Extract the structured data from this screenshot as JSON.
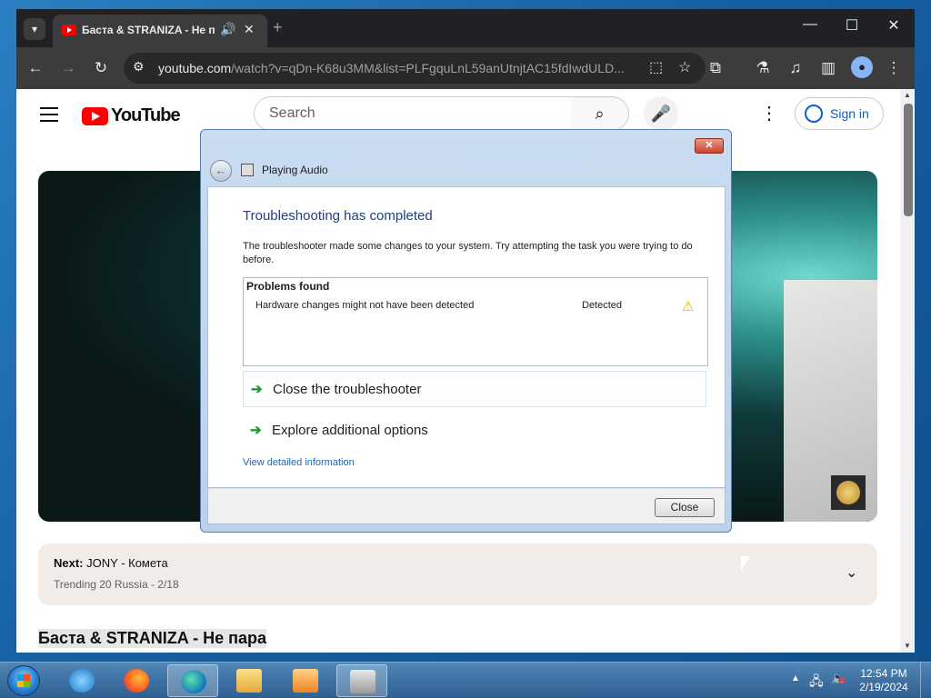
{
  "browser": {
    "tab_title": "Баста & STRANIZA - Не па",
    "new_tab_symbol": "+",
    "url_host": "youtube.com",
    "url_path": "/watch?v=qDn-K68u3MM&list=PLFgquLnL59anUtnjtAC15fdIwdULD...",
    "window_controls": {
      "minimize": "—",
      "maximize": "☐",
      "close": "✕"
    }
  },
  "youtube": {
    "logo_text": "YouTube",
    "search_placeholder": "Search",
    "sign_in": "Sign in",
    "next_label": "Next:",
    "next_title": "JONY - Комета",
    "next_sub": "Trending 20 Russia - 2/18",
    "video_title": "Баста & STRANIZA - Не пара"
  },
  "dialog": {
    "title": "Playing Audio",
    "heading": "Troubleshooting has completed",
    "body": "The troubleshooter made some changes to your system. Try attempting the task you were trying to do before.",
    "problems_header": "Problems found",
    "problems": [
      {
        "description": "Hardware changes might not have been detected",
        "status": "Detected",
        "icon": "warning-icon"
      }
    ],
    "option_close": "Close the troubleshooter",
    "option_explore": "Explore additional options",
    "link_details": "View detailed information",
    "close_button": "Close"
  },
  "taskbar": {
    "time": "12:54 PM",
    "date": "2/19/2024",
    "apps": [
      "internet-explorer",
      "firefox",
      "edge",
      "file-explorer",
      "media-player",
      "troubleshooter"
    ]
  },
  "colors": {
    "youtube_red": "#ff0000",
    "dialog_heading": "#1e3f87",
    "link": "#2267b5",
    "arrow_green": "#1b9d2d"
  }
}
